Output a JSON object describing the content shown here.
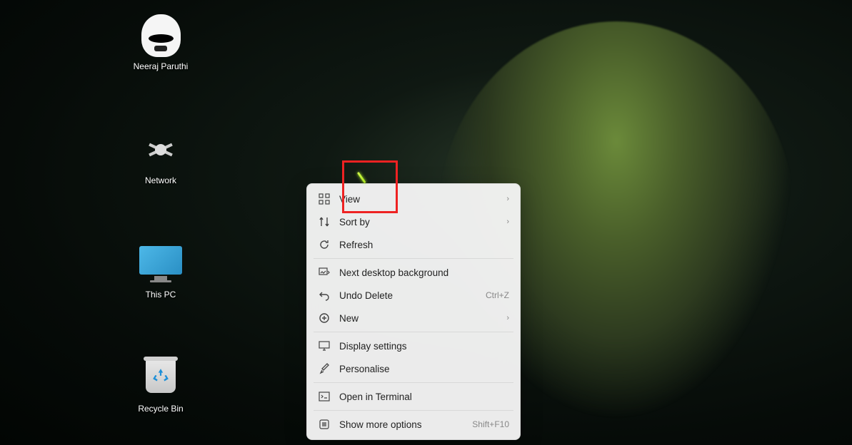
{
  "desktop_icons": [
    {
      "id": "user-folder",
      "label": "Neeraj Paruthi"
    },
    {
      "id": "network",
      "label": "Network"
    },
    {
      "id": "this-pc",
      "label": "This PC"
    },
    {
      "id": "recycle-bin",
      "label": "Recycle Bin"
    }
  ],
  "context_menu": {
    "groups": [
      [
        {
          "icon": "grid-icon",
          "label": "View",
          "submenu": true
        },
        {
          "icon": "sort-icon",
          "label": "Sort by",
          "submenu": true
        },
        {
          "icon": "refresh-icon",
          "label": "Refresh"
        }
      ],
      [
        {
          "icon": "image-next-icon",
          "label": "Next desktop background"
        },
        {
          "icon": "undo-icon",
          "label": "Undo Delete",
          "shortcut": "Ctrl+Z"
        },
        {
          "icon": "plus-circle-icon",
          "label": "New",
          "submenu": true
        }
      ],
      [
        {
          "icon": "display-icon",
          "label": "Display settings"
        },
        {
          "icon": "brush-icon",
          "label": "Personalise"
        }
      ],
      [
        {
          "icon": "terminal-icon",
          "label": "Open in Terminal"
        }
      ],
      [
        {
          "icon": "more-icon",
          "label": "Show more options",
          "shortcut": "Shift+F10"
        }
      ]
    ]
  },
  "chevron_glyph": "›"
}
